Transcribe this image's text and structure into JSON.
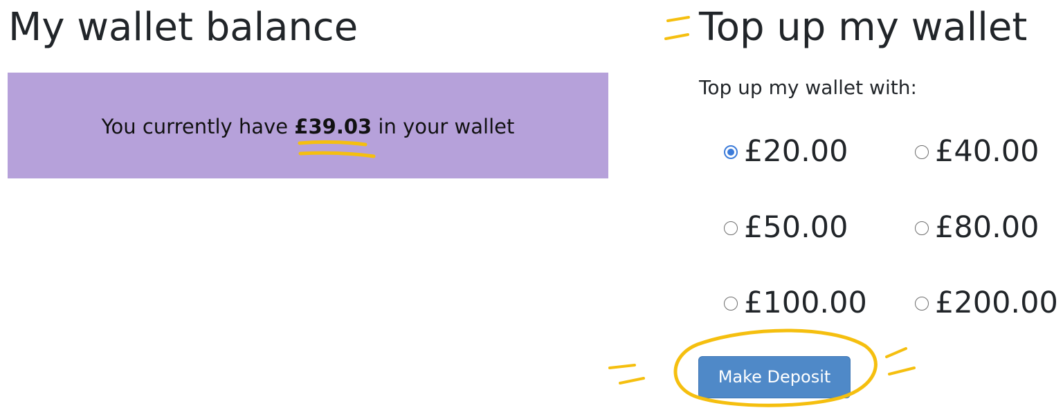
{
  "balance_section": {
    "title": "My wallet balance",
    "text_before": "You currently have ",
    "amount": "£39.03",
    "text_after": " in your wallet"
  },
  "topup_section": {
    "title": "Top up my wallet",
    "label": "Top up my wallet with:",
    "selected_option": "£20.00",
    "options": [
      {
        "label": "£20.00",
        "checked": true
      },
      {
        "label": "£40.00",
        "checked": false
      },
      {
        "label": "£50.00",
        "checked": false
      },
      {
        "label": "£80.00",
        "checked": false
      },
      {
        "label": "£100.00",
        "checked": false
      },
      {
        "label": "£200.00",
        "checked": false
      }
    ],
    "button_label": "Make Deposit"
  },
  "colors": {
    "balance_panel": "#b6a1da",
    "button": "#4f89c8",
    "radio_checked": "#3b7bd9",
    "annotation": "#f5bf0f"
  }
}
